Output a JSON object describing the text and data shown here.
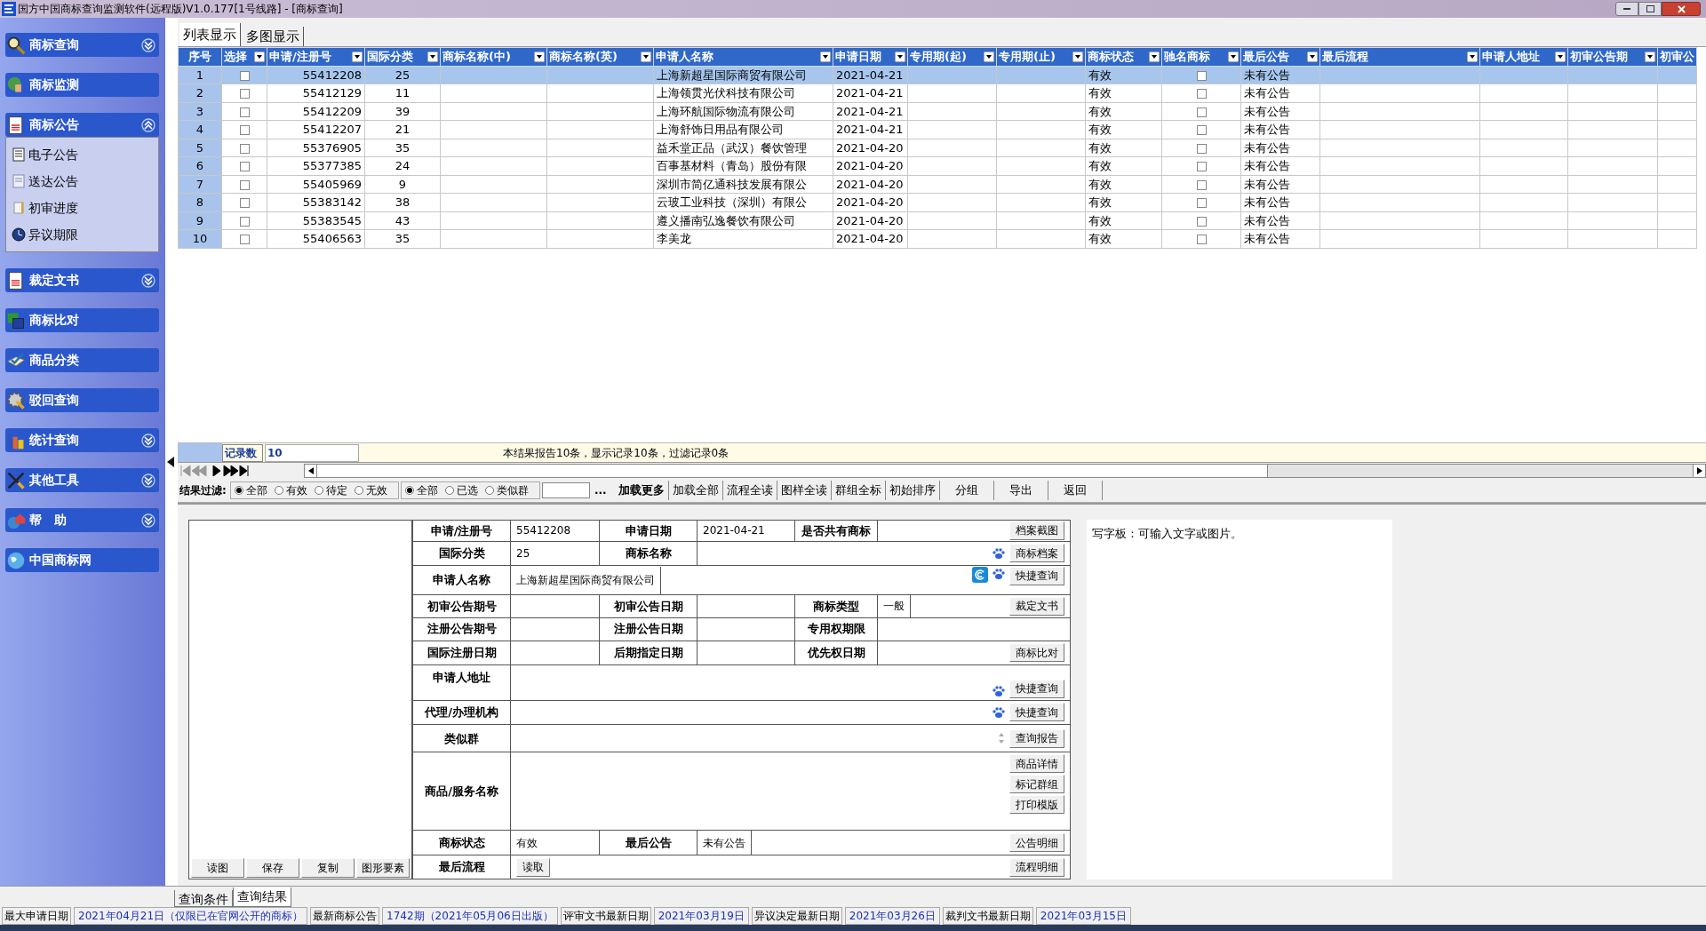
{
  "window": {
    "title": "国方中国商标查询监测软件(远程版)V1.0.177[1号线路] - [商标查询]"
  },
  "sidebar": {
    "groups": [
      {
        "label": "商标查询",
        "expanded": false
      },
      {
        "label": "商标监测"
      },
      {
        "label": "商标公告",
        "expanded": true,
        "items": [
          {
            "label": "电子公告"
          },
          {
            "label": "送达公告"
          },
          {
            "label": "初审进度"
          },
          {
            "label": "异议期限"
          }
        ]
      },
      {
        "label": "裁定文书",
        "expanded": false
      },
      {
        "label": "商标比对"
      },
      {
        "label": "商品分类"
      },
      {
        "label": "驳回查询"
      },
      {
        "label": "统计查询",
        "expanded": false
      },
      {
        "label": "其他工具",
        "expanded": false
      },
      {
        "label": "帮　助",
        "expanded": false
      },
      {
        "label": "中国商标网"
      }
    ]
  },
  "view_tabs": [
    {
      "label": "列表显示",
      "selected": true
    },
    {
      "label": "多图显示",
      "selected": false
    }
  ],
  "table": {
    "columns": [
      "序号",
      "选择",
      "申请/注册号",
      "国际分类",
      "商标名称(中)",
      "商标名称(英)",
      "申请人名称",
      "申请日期",
      "专用期(起)",
      "专用期(止)",
      "商标状态",
      "驰名商标",
      "最后公告",
      "最后流程",
      "申请人地址",
      "初审公告期",
      "初审公"
    ],
    "rows": [
      {
        "no": "1",
        "selected": true,
        "checked": false,
        "reg_no": "55412208",
        "class": "25",
        "applicant": "上海新超星国际商贸有限公司",
        "date": "2021-04-21",
        "status": "有效",
        "famous": false,
        "last_notice": "未有公告"
      },
      {
        "no": "2",
        "selected": false,
        "checked": false,
        "reg_no": "55412129",
        "class": "11",
        "applicant": "上海领贯光伏科技有限公司",
        "date": "2021-04-21",
        "status": "有效",
        "famous": false,
        "last_notice": "未有公告"
      },
      {
        "no": "3",
        "selected": false,
        "checked": false,
        "reg_no": "55412209",
        "class": "39",
        "applicant": "上海环航国际物流有限公司",
        "date": "2021-04-21",
        "status": "有效",
        "famous": false,
        "last_notice": "未有公告"
      },
      {
        "no": "4",
        "selected": false,
        "checked": false,
        "reg_no": "55412207",
        "class": "21",
        "applicant": "上海舒饰日用品有限公司",
        "date": "2021-04-21",
        "status": "有效",
        "famous": false,
        "last_notice": "未有公告"
      },
      {
        "no": "5",
        "selected": false,
        "checked": false,
        "reg_no": "55376905",
        "class": "35",
        "applicant": "益禾堂正品（武汉）餐饮管理",
        "date": "2021-04-20",
        "status": "有效",
        "famous": false,
        "last_notice": "未有公告"
      },
      {
        "no": "6",
        "selected": false,
        "checked": false,
        "reg_no": "55377385",
        "class": "24",
        "applicant": "百事基材料（青岛）股份有限",
        "date": "2021-04-20",
        "status": "有效",
        "famous": false,
        "last_notice": "未有公告"
      },
      {
        "no": "7",
        "selected": false,
        "checked": false,
        "reg_no": "55405969",
        "class": "9",
        "applicant": "深圳市简亿通科技发展有限公",
        "date": "2021-04-20",
        "status": "有效",
        "famous": false,
        "last_notice": "未有公告"
      },
      {
        "no": "8",
        "selected": false,
        "checked": false,
        "reg_no": "55383142",
        "class": "38",
        "applicant": "云玻工业科技（深圳）有限公",
        "date": "2021-04-20",
        "status": "有效",
        "famous": false,
        "last_notice": "未有公告"
      },
      {
        "no": "9",
        "selected": false,
        "checked": false,
        "reg_no": "55383545",
        "class": "43",
        "applicant": "遵义播南弘逸餐饮有限公司",
        "date": "2021-04-20",
        "status": "有效",
        "famous": false,
        "last_notice": "未有公告"
      },
      {
        "no": "10",
        "selected": false,
        "checked": false,
        "reg_no": "55406563",
        "class": "35",
        "applicant": "李美龙",
        "date": "2021-04-20",
        "status": "有效",
        "famous": false,
        "last_notice": "未有公告"
      }
    ]
  },
  "record_bar": {
    "label": "记录数",
    "count": "10",
    "message": "本结果报告10条，显示记录10条，过滤记录0条"
  },
  "filter": {
    "label": "结果过滤:",
    "group_1": [
      {
        "label": "全部",
        "selected": true
      },
      {
        "label": "有效",
        "selected": false
      },
      {
        "label": "待定",
        "selected": false
      },
      {
        "label": "无效",
        "selected": false
      }
    ],
    "group_2": [
      {
        "label": "全部",
        "selected": true
      },
      {
        "label": "已选",
        "selected": false
      },
      {
        "label": "类似群",
        "selected": false
      }
    ],
    "more": "...",
    "buttons": [
      {
        "label": "加载更多",
        "bold": true
      },
      {
        "label": "加载全部",
        "bold": false
      },
      {
        "label": "流程全读",
        "bold": false
      },
      {
        "label": "图样全读",
        "bold": false
      },
      {
        "label": "群组全标",
        "bold": false
      },
      {
        "label": "初始排序",
        "bold": false
      },
      {
        "label": "分组",
        "bold": false
      },
      {
        "label": "导出",
        "bold": false
      },
      {
        "label": "返回",
        "bold": false
      }
    ]
  },
  "image_panel": {
    "buttons": [
      "读图",
      "保存",
      "复制",
      "图形要素"
    ]
  },
  "detail": {
    "rows": [
      {
        "fields": [
          {
            "label": "申请/注册号",
            "value": "55412208"
          },
          {
            "label": "申请日期",
            "value": "2021-04-21"
          },
          {
            "label": "是否共有商标"
          }
        ],
        "buttons": [
          "档案截图"
        ]
      },
      {
        "fields": [
          {
            "label": "国际分类",
            "value": "25"
          },
          {
            "label": "商标名称"
          }
        ],
        "icons": [
          {
            "kind": "paw"
          }
        ],
        "buttons": [
          "商标档案"
        ]
      },
      {
        "fields": [
          {
            "label": "申请人名称",
            "value": "上海新超星国际商贸有限公司"
          }
        ],
        "icons": [
          {
            "kind": "swirl"
          },
          {
            "kind": "paw"
          }
        ],
        "buttons": [
          "快捷查询"
        ]
      },
      {
        "fields": [
          {
            "label": "初审公告期号"
          },
          {
            "label": "初审公告日期"
          },
          {
            "label": "商标类型",
            "value": "一般"
          }
        ],
        "buttons": [
          "裁定文书"
        ]
      },
      {
        "fields": [
          {
            "label": "注册公告期号"
          },
          {
            "label": "注册公告日期"
          },
          {
            "label": "专用权期限"
          }
        ]
      },
      {
        "fields": [
          {
            "label": "国际注册日期"
          },
          {
            "label": "后期指定日期"
          },
          {
            "label": "优先权日期"
          }
        ],
        "buttons": [
          "商标比对"
        ]
      },
      {
        "fields": [
          {
            "label": "申请人地址"
          }
        ],
        "icons": [
          {
            "kind": "paw"
          }
        ],
        "buttons": [
          "快捷查询"
        ]
      },
      {
        "fields": [
          {
            "label": "代理/办理机构"
          }
        ],
        "icons": [
          {
            "kind": "paw"
          }
        ],
        "buttons": [
          "快捷查询"
        ]
      },
      {
        "fields": [
          {
            "label": "类似群"
          }
        ],
        "icons": [
          {
            "kind": "spinner"
          }
        ],
        "buttons": [
          "查询报告"
        ]
      },
      {
        "fields": [
          {
            "label": "商品/服务名称"
          }
        ],
        "buttons": [
          "商品详情",
          "标记群组",
          "打印模版"
        ]
      },
      {
        "fields": [
          {
            "label": "商标状态",
            "value": "有效"
          },
          {
            "label": "最后公告",
            "value": "未有公告"
          }
        ],
        "buttons": [
          "公告明细"
        ]
      },
      {
        "fields": [
          {
            "label": "最后流程",
            "action": "读取"
          }
        ],
        "buttons": [
          "流程明细"
        ]
      }
    ]
  },
  "notepad": {
    "text": "写字板：可输入文字或图片。"
  },
  "bottom_tabs": [
    {
      "label": "查询条件",
      "selected": false
    },
    {
      "label": "查询结果",
      "selected": true
    }
  ],
  "status_bar": [
    {
      "label": "最大申请日期",
      "value": "2021年04月21日（仅限已在官网公开的商标）"
    },
    {
      "label": "最新商标公告",
      "value": "1742期（2021年05月06日出版）"
    },
    {
      "label": "评审文书最新日期",
      "value": "2021年03月19日"
    },
    {
      "label": "异议决定最新日期",
      "value": "2021年03月26日"
    },
    {
      "label": "裁判文书最新日期",
      "value": "2021年03月15日"
    }
  ]
}
